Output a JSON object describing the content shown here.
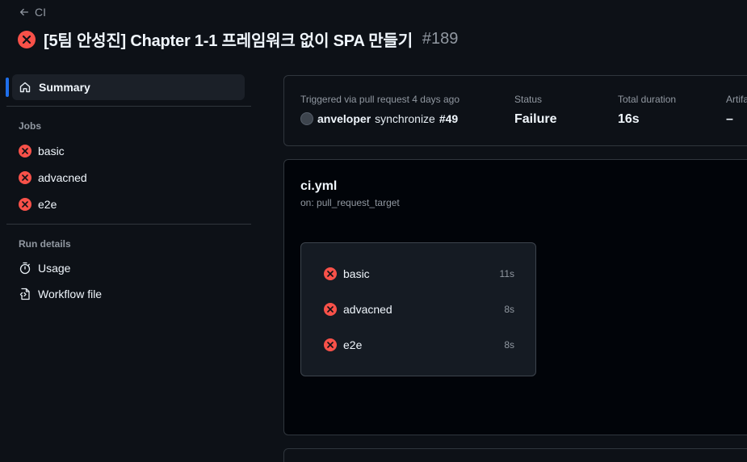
{
  "header": {
    "back_label": "CI",
    "title": "[5팀 안성진] Chapter 1-1 프레임워크 없이 SPA 만들기",
    "run_number": "#189",
    "status": "failure"
  },
  "sidebar": {
    "summary_label": "Summary",
    "jobs_heading": "Jobs",
    "jobs": [
      {
        "label": "basic",
        "status": "failure"
      },
      {
        "label": "advacned",
        "status": "failure"
      },
      {
        "label": "e2e",
        "status": "failure"
      }
    ],
    "run_details_heading": "Run details",
    "run_details": [
      {
        "label": "Usage",
        "icon": "stopwatch-icon"
      },
      {
        "label": "Workflow file",
        "icon": "file-code-icon"
      }
    ]
  },
  "summary": {
    "triggered_label": "Triggered via pull request 4 days ago",
    "actor": "anveloper",
    "event": "synchronize",
    "pr": "#49",
    "status_label": "Status",
    "status_value": "Failure",
    "duration_label": "Total duration",
    "duration_value": "16s",
    "artifacts_label": "Artifa",
    "artifacts_value": "–"
  },
  "workflow": {
    "name": "ci.yml",
    "trigger": "on: pull_request_target",
    "jobs": [
      {
        "label": "basic",
        "duration": "11s",
        "status": "failure"
      },
      {
        "label": "advacned",
        "duration": "8s",
        "status": "failure"
      },
      {
        "label": "e2e",
        "duration": "8s",
        "status": "failure"
      }
    ]
  },
  "colors": {
    "failure": "#f85149",
    "accent": "#1f6feb",
    "background": "#0d1117"
  }
}
